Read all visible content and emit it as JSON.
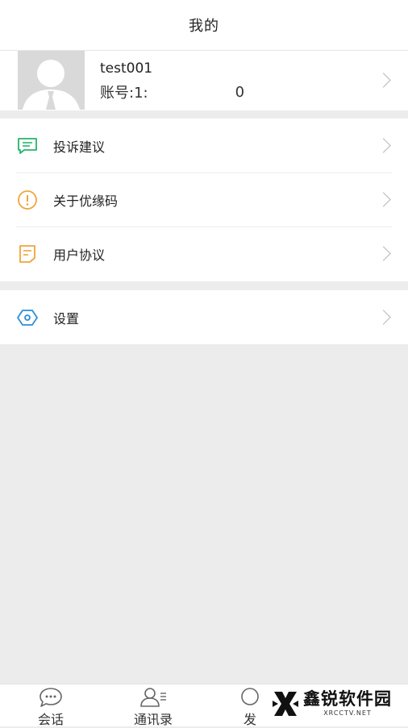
{
  "header": {
    "title": "我的"
  },
  "profile": {
    "username": "test001",
    "account_prefix": "账号:1:",
    "account_suffix": "0",
    "avatar_icon": "default-avatar-icon"
  },
  "menu_group_1": [
    {
      "label": "投诉建议",
      "icon": "message-square-icon",
      "color": "#27b36b"
    },
    {
      "label": "关于优缘码",
      "icon": "info-circle-icon",
      "color": "#f0a43a"
    },
    {
      "label": "用户协议",
      "icon": "document-icon",
      "color": "#f0a43a"
    }
  ],
  "menu_group_2": [
    {
      "label": "设置",
      "icon": "settings-hexagon-icon",
      "color": "#2d8fd5"
    }
  ],
  "bottom_nav": [
    {
      "label": "会话",
      "icon": "chat-bubble-icon"
    },
    {
      "label": "通讯录",
      "icon": "contacts-icon"
    },
    {
      "label": "发",
      "icon": "discover-icon"
    }
  ],
  "watermark": {
    "title": "鑫锐软件园",
    "subtitle": "XRCCTV.NET"
  }
}
